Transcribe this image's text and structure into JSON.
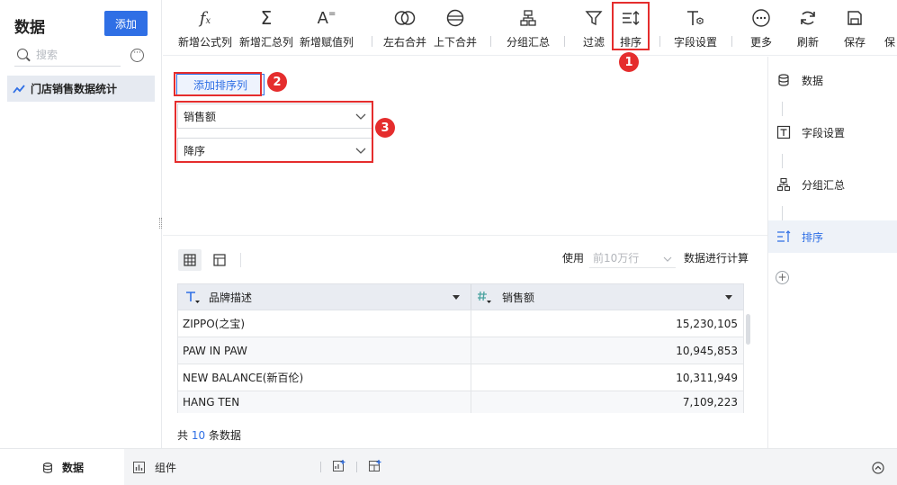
{
  "left_panel": {
    "title": "数据",
    "add_button": "添加",
    "search_placeholder": "搜索",
    "dataset_name": "门店销售数据统计"
  },
  "toolbar": {
    "items": [
      {
        "label": "新增公式列",
        "icon": "formula-icon"
      },
      {
        "label": "新增汇总列",
        "icon": "sigma-icon"
      },
      {
        "label": "新增赋值列",
        "icon": "assign-icon"
      },
      {
        "label": "左右合并",
        "icon": "merge-horizontal-icon"
      },
      {
        "label": "上下合并",
        "icon": "merge-vertical-icon"
      },
      {
        "label": "分组汇总",
        "icon": "group-summary-icon"
      },
      {
        "label": "过滤",
        "icon": "filter-icon"
      },
      {
        "label": "排序",
        "icon": "sort-icon"
      },
      {
        "label": "字段设置",
        "icon": "field-settings-icon"
      },
      {
        "label": "更多",
        "icon": "more-icon"
      },
      {
        "label": "刷新",
        "icon": "refresh-icon"
      },
      {
        "label": "保存",
        "icon": "save-icon"
      },
      {
        "label": "保",
        "icon": "save-as-icon"
      }
    ]
  },
  "editor": {
    "add_sort_button": "添加排序列",
    "sort_field": "销售额",
    "sort_order": "降序"
  },
  "badges": [
    "1",
    "2",
    "3"
  ],
  "preview": {
    "use_label": "使用",
    "row_limit": "前10万行",
    "calc_label": "数据进行计算",
    "columns": [
      {
        "name": "品牌描述",
        "type_icon": "text-type-icon"
      },
      {
        "name": "销售额",
        "type_icon": "number-type-icon"
      }
    ],
    "rows": [
      {
        "brand": "ZIPPO(之宝)",
        "sales": "15,230,105"
      },
      {
        "brand": "PAW IN PAW",
        "sales": "10,945,853"
      },
      {
        "brand": "NEW BALANCE(新百伦)",
        "sales": "10,311,949"
      },
      {
        "brand": "HANG TEN",
        "sales": "7,109,223"
      }
    ],
    "count_prefix": "共",
    "count_value": "10",
    "count_suffix": "条数据"
  },
  "steps": [
    {
      "label": "数据",
      "icon": "database-icon",
      "active": false
    },
    {
      "label": "字段设置",
      "icon": "field-settings-icon",
      "active": false
    },
    {
      "label": "分组汇总",
      "icon": "group-summary-icon",
      "active": false
    },
    {
      "label": "排序",
      "icon": "sort-icon",
      "active": true
    }
  ],
  "bottom_bar": {
    "tab_data": "数据",
    "tab_component": "组件"
  },
  "colors": {
    "accent": "#2f6fe5",
    "highlight_red": "#e52d2d"
  }
}
